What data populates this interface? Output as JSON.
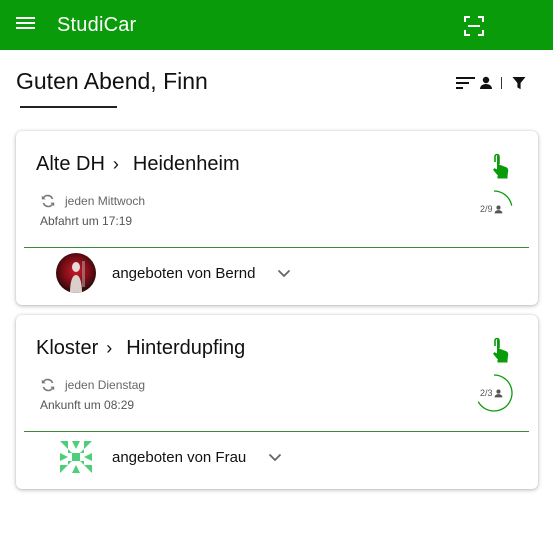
{
  "app": {
    "title": "StudiCar",
    "accent_color": "#0a9b0a",
    "menu_icon": "menu-icon",
    "scan_icon": "qr-scan-icon"
  },
  "greeting": {
    "text": "Guten Abend, Finn"
  },
  "toolbar": {
    "sort_icon": "sort-icon",
    "person_icon": "person-icon",
    "filter_icon": "filter-icon"
  },
  "rides": [
    {
      "from": "Alte DH",
      "separator": "›",
      "to": "Heidenheim",
      "recurrence": "jeden Mittwoch",
      "time_info": "Abfahrt um 17:19",
      "seats": "2/9",
      "seats_fraction": 0.22,
      "offered_by": "angeboten von Bernd",
      "avatar": "photo-avatar"
    },
    {
      "from": "Kloster",
      "separator": "›",
      "to": "Hinterdupfing",
      "recurrence": "jeden Dienstag",
      "time_info": "Ankunft um 08:29",
      "seats": "2/3",
      "seats_fraction": 0.67,
      "offered_by": "angeboten von Frau",
      "avatar": "identicon-avatar"
    }
  ]
}
